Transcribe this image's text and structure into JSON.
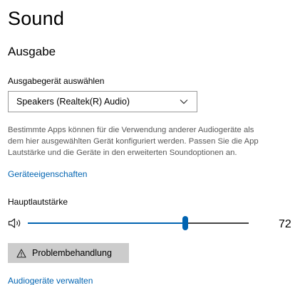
{
  "page": {
    "title": "Sound"
  },
  "output": {
    "heading": "Ausgabe",
    "device_label": "Ausgabegerät auswählen",
    "device_selected": "Speakers (Realtek(R) Audio)",
    "description_lines": [
      "Bestimmte Apps können für die Verwendung anderer Audiogeräte als",
      "dem hier ausgewählten Gerät konfiguriert werden. Passen Sie die App",
      "Lautstärke und die Geräte in den erweiterten Soundoptionen an."
    ],
    "device_properties_link": "Geräteeigenschaften",
    "master_volume_label": "Hauptlautstärke",
    "volume_value": "72",
    "volume_percent": 72,
    "speaker_icon": "speaker-volume-icon",
    "troubleshoot_button": "Problembehandlung",
    "troubleshoot_icon": "warning-icon",
    "manage_devices_link": "Audiogeräte verwalten"
  },
  "colors": {
    "accent": "#0063b1",
    "button_bg": "#cccccc",
    "description_text": "#595959"
  }
}
